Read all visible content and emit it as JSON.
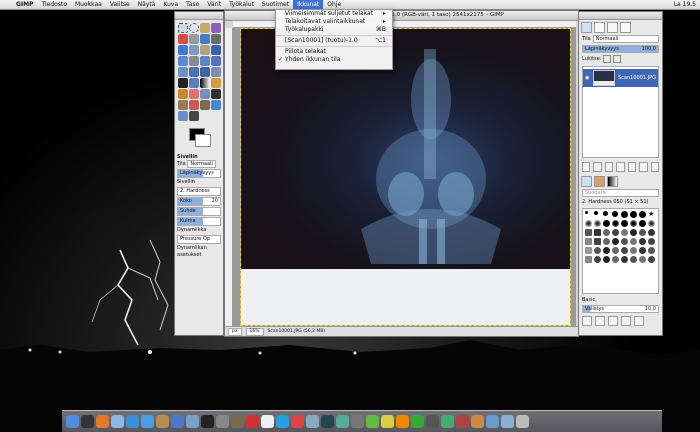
{
  "menubar": {
    "app_name": "GIMP",
    "menus": [
      "Tiedosto",
      "Muokkaa",
      "Valitse",
      "Näytä",
      "Kuva",
      "Taso",
      "Värit",
      "Työkalut",
      "Suotimet",
      "Ikkunat",
      "Ohje"
    ],
    "active_menu": "Ikkunat",
    "clock": "La 19.5"
  },
  "windows_menu": {
    "items": [
      {
        "label": "Viimeisimmät suljetut telakat",
        "shortcut": "▸"
      },
      {
        "label": "Telakoitavat valintaikkunat",
        "shortcut": "▸"
      },
      {
        "label": "Työkalupakki",
        "shortcut": "⌘B"
      },
      {
        "label": "[Scan10001] (tuotu)-1.0",
        "shortcut": "⌥1"
      },
      {
        "label": "Piilota telakat",
        "shortcut": ""
      },
      {
        "label": "Yhden ikkunan tila",
        "shortcut": "",
        "checked": true
      }
    ]
  },
  "image_window": {
    "title": "1.0 (RGB-väri, 1 taso) 2541x2175 – GIMP",
    "status": {
      "unit": "px",
      "zoom": "16%",
      "filename": "Scan10001.JPG (56,2 MB)"
    }
  },
  "toolbox": {
    "options_title": "Sivellin",
    "mode_label": "Tila",
    "mode_value": "Normaali",
    "opacity_label": "Läpinäkyvyys",
    "brush_label": "Sivellin",
    "brush_value": "2. Hardness",
    "size_label": "Koko",
    "size_value": "20",
    "aspect_label": "Suhde",
    "angle_label": "Kulma",
    "dynamics_label": "Dynamiikka",
    "dynamics_value": "Pressure Op",
    "dynamics_options": "Dynamiikan asetukset"
  },
  "layers_panel": {
    "mode_label": "Tila",
    "mode_value": "Normaali",
    "opacity_label": "Läpinäkyvyys",
    "opacity_value": "100,0",
    "lock_label": "Lukitse:",
    "layer_name": "Scan10001.JPG"
  },
  "brushes_panel": {
    "filter_placeholder": "Suodata",
    "brush_name": "2. Hardness 050 (51 × 51)",
    "tag_label": "Basic,",
    "spacing_label": "Välistys",
    "spacing_value": "10,0"
  },
  "colors": {
    "accent": "#3d6fd8",
    "selection": "#3f67b5",
    "foreground": "#000000",
    "background": "#ffffff"
  }
}
